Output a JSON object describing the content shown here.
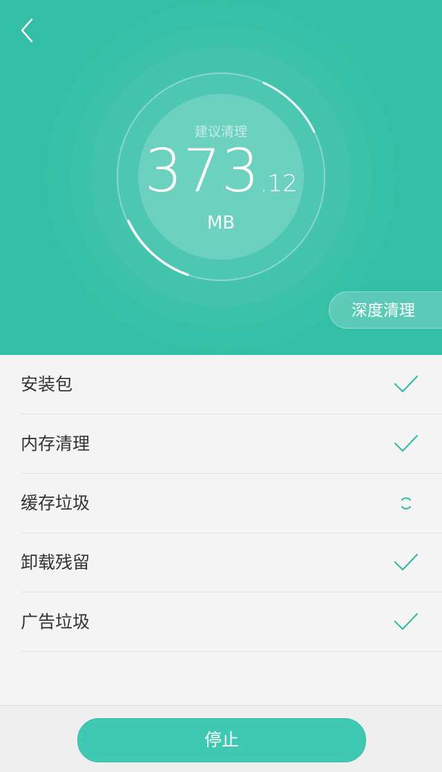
{
  "header": {
    "back_icon": "chevron-left-icon",
    "suggest_label": "建议清理",
    "amount_int": "373",
    "amount_dec": ".12",
    "unit": "MB",
    "deep_clean_label": "深度清理"
  },
  "items": [
    {
      "label": "安装包",
      "status": "done"
    },
    {
      "label": "内存清理",
      "status": "done"
    },
    {
      "label": "缓存垃圾",
      "status": "scanning"
    },
    {
      "label": "卸载残留",
      "status": "done"
    },
    {
      "label": "广告垃圾",
      "status": "done"
    }
  ],
  "footer": {
    "stop_label": "停止"
  },
  "colors": {
    "accent": "#32bfa5",
    "button": "#3fc9b3",
    "check": "#33bca3"
  }
}
